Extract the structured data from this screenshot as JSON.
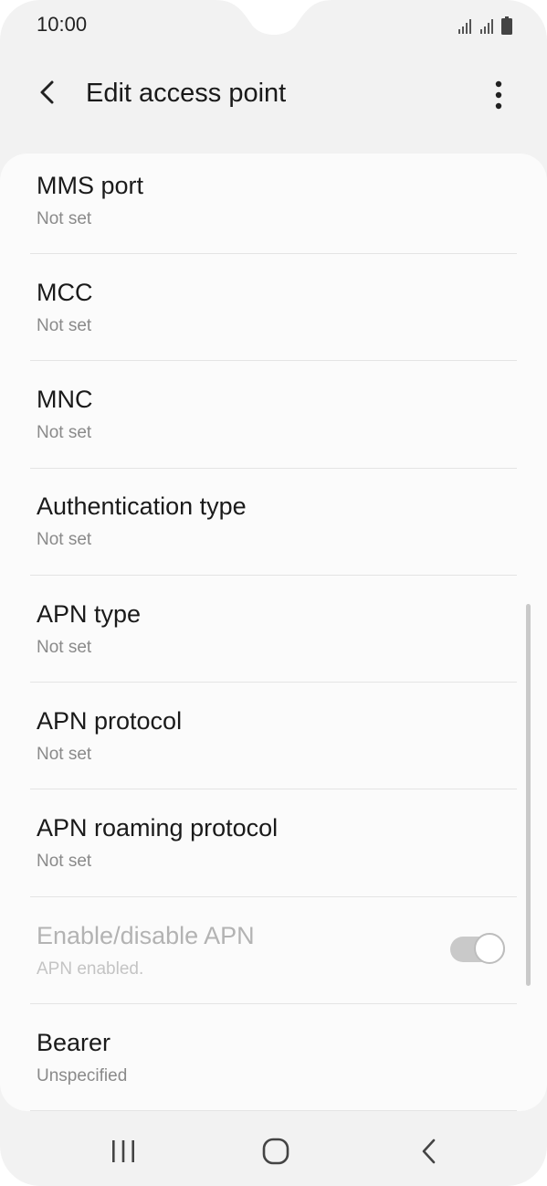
{
  "status_bar": {
    "time": "10:00",
    "icons": [
      "signal-icon",
      "signal-icon",
      "battery-icon"
    ]
  },
  "header": {
    "title": "Edit access point",
    "back_icon": "back-arrow-icon",
    "more_icon": "more-vertical-icon"
  },
  "settings": [
    {
      "title": "MMS port",
      "subtitle": "Not set"
    },
    {
      "title": "MCC",
      "subtitle": "Not set"
    },
    {
      "title": "MNC",
      "subtitle": "Not set"
    },
    {
      "title": "Authentication type",
      "subtitle": "Not set"
    },
    {
      "title": "APN type",
      "subtitle": "Not set"
    },
    {
      "title": "APN protocol",
      "subtitle": "Not set"
    },
    {
      "title": "APN roaming protocol",
      "subtitle": "Not set"
    },
    {
      "title": "Enable/disable APN",
      "subtitle": "APN enabled.",
      "enabled": false,
      "toggle_on": true
    },
    {
      "title": "Bearer",
      "subtitle": "Unspecified"
    }
  ],
  "navbar": {
    "icons": [
      "recent-apps-icon",
      "home-icon",
      "back-icon"
    ]
  },
  "colors": {
    "background": "#f2f2f2",
    "card": "#fbfbfb",
    "primary_text": "#1a1a1a",
    "secondary_text": "#8a8a8a"
  }
}
